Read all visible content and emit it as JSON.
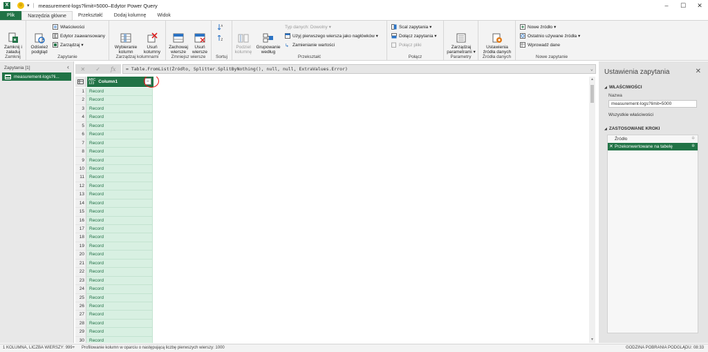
{
  "titlebar": {
    "excel_logo": "X",
    "title": "measurement-logs?limit=5000–Edytor Power Query",
    "minimize": "–",
    "maximize": "☐",
    "close": "✕"
  },
  "tabs": [
    "Plik",
    "Narzędzia główne",
    "Przekształć",
    "Dodaj kolumnę",
    "Widok"
  ],
  "ribbon": {
    "close_load": "Zamknij i\nzaładuj",
    "close_label": "Zamknij",
    "refresh": "Odśwież\npodgląd",
    "properties": "Właściwości",
    "advanced_editor": "Edytor zaawansowany",
    "manage": "Zarządzaj",
    "query_label": "Zapytanie",
    "choose_columns": "Wybieranie\nkolumn",
    "remove_columns": "Usuń\nkolumny",
    "manage_cols_label": "Zarządzaj kolumnami",
    "keep_rows": "Zachowaj\nwiersze",
    "remove_rows": "Usuń\nwiersze",
    "reduce_rows_label": "Zmniejsz wiersze",
    "sort_label": "Sortuj",
    "split_column": "Podziel\nkolumnę",
    "group_by": "Grupowanie\nwedług",
    "data_type": "Typ danych: Dowolny",
    "first_row_header": "Użyj pierwszego wiersza jako nagłówków",
    "replace_values": "Zamienianie wartości",
    "transform_label": "Przekształć",
    "merge_queries": "Scal zapytania",
    "append_queries": "Dołącz zapytania",
    "combine_files": "Połącz pliki",
    "combine_label": "Połącz",
    "manage_params": "Zarządzaj\nparametrami",
    "params_label": "Parametry",
    "source_settings": "Ustawienia\nźródła danych",
    "sources_label": "Źródła danych",
    "new_source": "Nowe źródło",
    "recent_sources": "Ostatnio używane źródła",
    "enter_data": "Wprowadź dane",
    "new_query_label": "Nowe zapytanie"
  },
  "left_pane": {
    "header": "Zapytania [1]",
    "query": "measurement-logs?li..."
  },
  "formula": {
    "text": "= Table.FromList(Źródło, Splitter.SplitByNothing(), null, null, ExtraValues.Error)"
  },
  "grid": {
    "column_type": "ABC\n123",
    "column_name": "Column1",
    "cell_value": "Record",
    "rows": [
      "1",
      "2",
      "3",
      "4",
      "5",
      "6",
      "7",
      "8",
      "9",
      "10",
      "11",
      "12",
      "13",
      "14",
      "15",
      "16",
      "17",
      "18",
      "19",
      "20",
      "21",
      "22",
      "23",
      "24",
      "25",
      "26",
      "27",
      "28",
      "29",
      "30"
    ]
  },
  "right_pane": {
    "title": "Ustawienia zapytania",
    "props_section": "WŁAŚCIWOŚCI",
    "name_label": "Nazwa",
    "name_value": "measurement-logs?limit=5000",
    "all_props": "Wszystkie właściwości",
    "steps_section": "ZASTOSOWANE KROKI",
    "steps": [
      "Źródło",
      "Przekonwertowane na tabelę"
    ]
  },
  "status": {
    "left": "1 KOLUMNA, LICZBA WIERSZY: 999+",
    "middle": "Profilowanie kolumn w oparciu o następującą liczbę pierwszych wierszy: 1000",
    "right": "GODZINA POBRANIA PODGLĄDU: 08:33"
  },
  "colors": {
    "accent": "#217346",
    "cell": "#d8f0e2",
    "annotation": "#e11111"
  }
}
